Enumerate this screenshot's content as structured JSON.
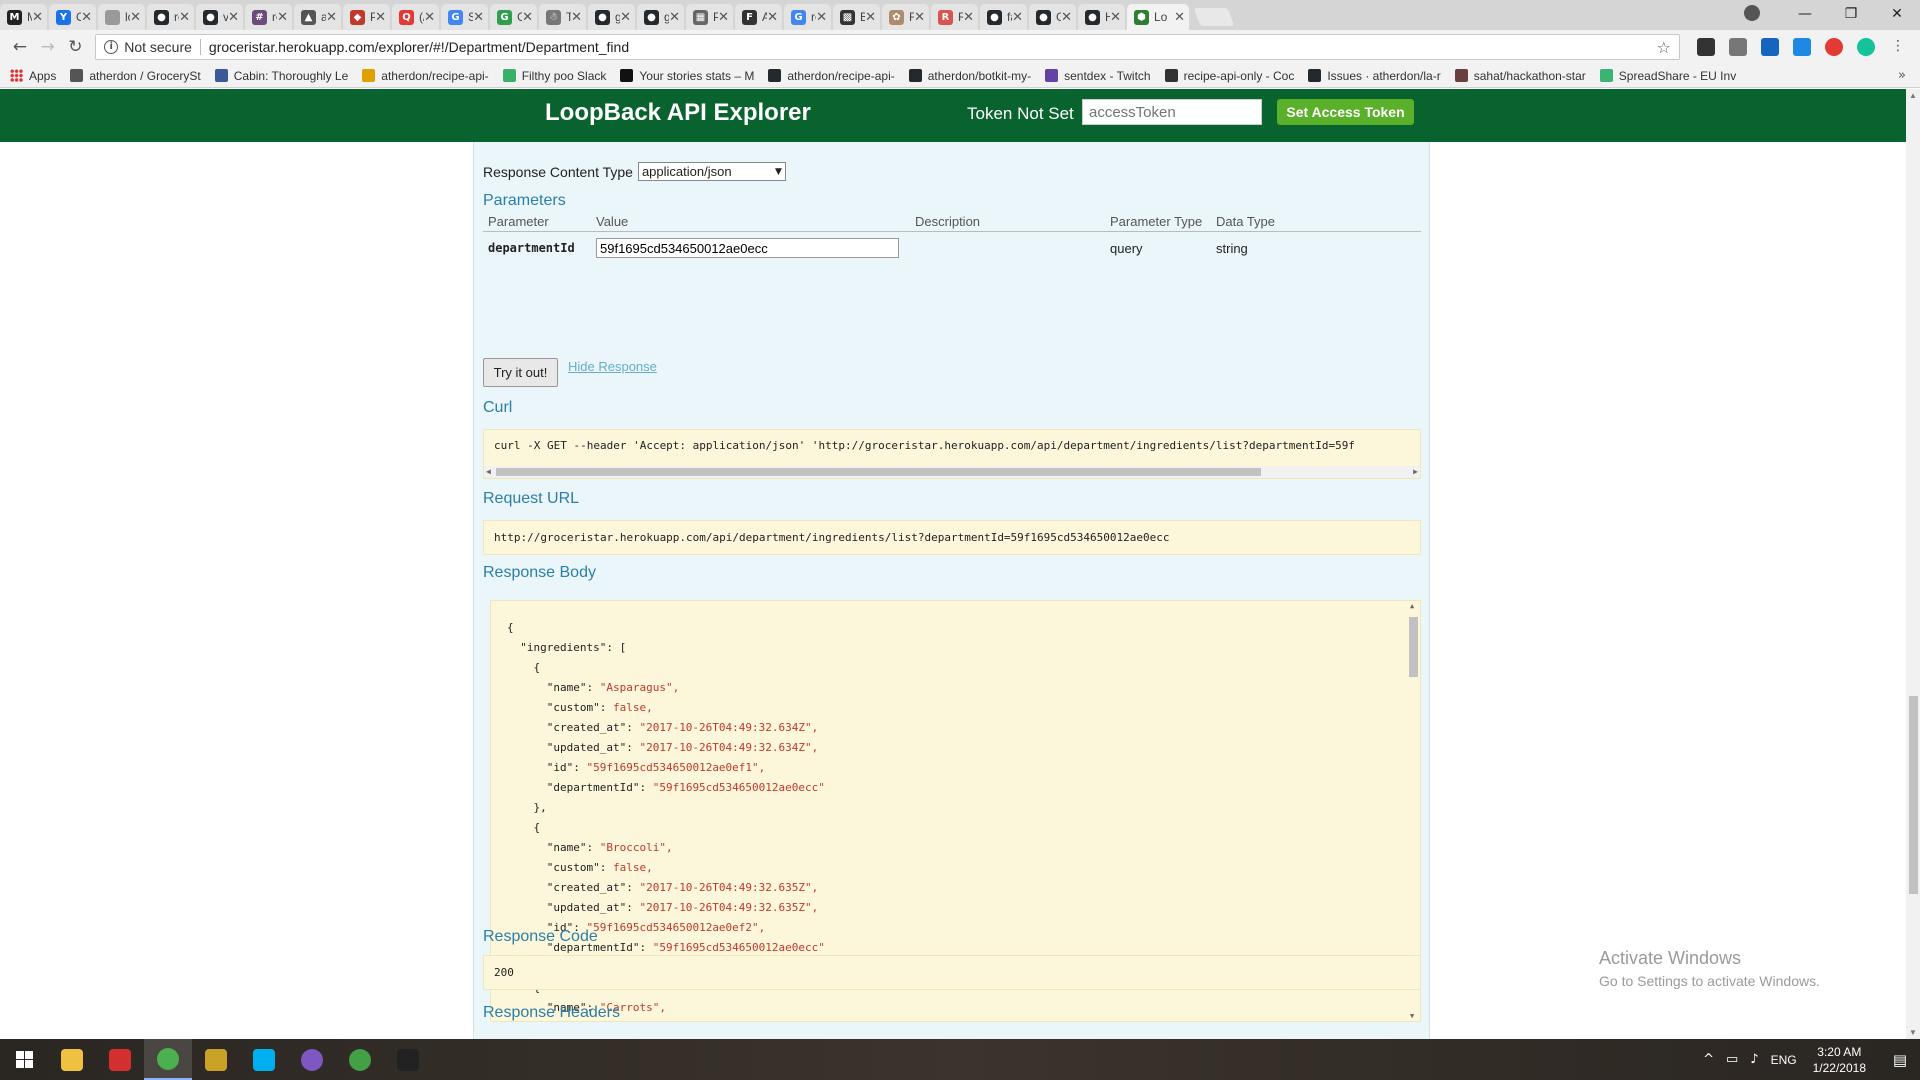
{
  "browser": {
    "tabs": [
      {
        "title": "M",
        "color": "#222222",
        "glyph": "M",
        "icon": "medium-icon"
      },
      {
        "title": "O",
        "color": "#1a73e8",
        "glyph": "Y",
        "icon": "vimeo-icon"
      },
      {
        "title": "lo",
        "color": "#999999",
        "glyph": "",
        "icon": "page-icon"
      },
      {
        "title": "re",
        "color": "#24292e",
        "glyph": "●",
        "icon": "github-icon"
      },
      {
        "title": "va",
        "color": "#24292e",
        "glyph": "●",
        "icon": "github-icon"
      },
      {
        "title": "re",
        "color": "#6b4b7a",
        "glyph": "#",
        "icon": "hash-icon"
      },
      {
        "title": "at",
        "color": "#555555",
        "glyph": "▲",
        "icon": "atlassian-icon"
      },
      {
        "title": "Pr",
        "color": "#c0392b",
        "glyph": "◆",
        "icon": "postman-icon"
      },
      {
        "title": "(/",
        "color": "#e53935",
        "glyph": "Q",
        "icon": "quora-icon"
      },
      {
        "title": "Sc",
        "color": "#4285f4",
        "glyph": "G",
        "icon": "google-icon"
      },
      {
        "title": "Gl",
        "color": "#2e9e4f",
        "glyph": "G",
        "icon": "glitch-icon"
      },
      {
        "title": "Tr",
        "color": "#777777",
        "glyph": "☃",
        "icon": "trello-icon"
      },
      {
        "title": "gr",
        "color": "#24292e",
        "glyph": "●",
        "icon": "github-icon"
      },
      {
        "title": "gr",
        "color": "#24292e",
        "glyph": "●",
        "icon": "github-icon"
      },
      {
        "title": "Pr",
        "color": "#666666",
        "glyph": "▦",
        "icon": "project-icon"
      },
      {
        "title": "A",
        "color": "#333333",
        "glyph": "F",
        "icon": "f-icon"
      },
      {
        "title": "re",
        "color": "#4285f4",
        "glyph": "G",
        "icon": "google-icon"
      },
      {
        "title": "Bl",
        "color": "#333333",
        "glyph": "▩",
        "icon": "blog-icon"
      },
      {
        "title": "Fu",
        "color": "#b08c6e",
        "glyph": "✿",
        "icon": "food-icon"
      },
      {
        "title": "Re",
        "color": "#d9534f",
        "glyph": "R",
        "icon": "reddit-icon"
      },
      {
        "title": "fa",
        "color": "#24292e",
        "glyph": "●",
        "icon": "github-icon"
      },
      {
        "title": "G",
        "color": "#24292e",
        "glyph": "●",
        "icon": "github-icon"
      },
      {
        "title": "H",
        "color": "#24292e",
        "glyph": "●",
        "icon": "github-icon"
      },
      {
        "title": "Lo",
        "color": "#2e7d32",
        "glyph": "⬢",
        "icon": "loopback-icon",
        "active": true
      }
    ],
    "not_secure_label": "Not secure",
    "url": "groceristar.herokuapp.com/explorer/#!/Department/Department_find",
    "bookmarks": [
      {
        "label": "Apps",
        "color": "#d33",
        "icon": "apps-icon"
      },
      {
        "label": "atherdon / GrocerySt",
        "color": "#555555",
        "icon": "atlassian-icon"
      },
      {
        "label": "Cabin: Thoroughly Le",
        "color": "#3b5998",
        "icon": "cabin-icon"
      },
      {
        "label": "atherdon/recipe-api-",
        "color": "#e0a000",
        "icon": "recipe-icon"
      },
      {
        "label": "Filthy poo Slack",
        "color": "#3aaf6a",
        "icon": "slack-icon"
      },
      {
        "label": "Your stories stats – M",
        "color": "#111111",
        "icon": "medium-icon"
      },
      {
        "label": "atherdon/recipe-api-",
        "color": "#24292e",
        "icon": "github-icon"
      },
      {
        "label": "atherdon/botkit-my-",
        "color": "#24292e",
        "icon": "github-icon"
      },
      {
        "label": "sentdex - Twitch",
        "color": "#6441a5",
        "icon": "twitch-icon"
      },
      {
        "label": "recipe-api-only - Coc",
        "color": "#333333",
        "icon": "codeship-icon"
      },
      {
        "label": "Issues · atherdon/la-r",
        "color": "#24292e",
        "icon": "github-icon"
      },
      {
        "label": "sahat/hackathon-star",
        "color": "#6a3f3f",
        "icon": "bookmark-icon"
      },
      {
        "label": "SpreadShare - EU Inv",
        "color": "#3cb371",
        "icon": "spreadshare-icon"
      }
    ]
  },
  "header": {
    "title": "LoopBack API Explorer",
    "token_label": "Token Not Set",
    "token_placeholder": "accessToken",
    "token_button": "Set Access Token"
  },
  "operation": {
    "response_content_type_label": "Response Content Type",
    "response_content_type_value": "application/json",
    "parameters_heading": "Parameters",
    "param_columns": [
      "Parameter",
      "Value",
      "Description",
      "Parameter Type",
      "Data Type"
    ],
    "param": {
      "name": "departmentId",
      "value": "59f1695cd534650012ae0ecc",
      "description": "",
      "parameter_type": "query",
      "data_type": "string"
    },
    "try_button": "Try it out!",
    "hide_response_link": "Hide Response",
    "curl_heading": "Curl",
    "curl_text": "curl -X GET --header 'Accept: application/json' 'http://groceristar.herokuapp.com/api/department/ingredients/list?departmentId=59f",
    "request_url_heading": "Request URL",
    "request_url": "http://groceristar.herokuapp.com/api/department/ingredients/list?departmentId=59f1695cd534650012ae0ecc",
    "response_body_heading": "Response Body",
    "response_body_lines": [
      "{",
      "  \"ingredients\": [",
      "    {",
      "      \"name\": \"Asparagus\",",
      "      \"custom\": false,",
      "      \"created_at\": \"2017-10-26T04:49:32.634Z\",",
      "      \"updated_at\": \"2017-10-26T04:49:32.634Z\",",
      "      \"id\": \"59f1695cd534650012ae0ef1\",",
      "      \"departmentId\": \"59f1695cd534650012ae0ecc\"",
      "    },",
      "    {",
      "      \"name\": \"Broccoli\",",
      "      \"custom\": false,",
      "      \"created_at\": \"2017-10-26T04:49:32.635Z\",",
      "      \"updated_at\": \"2017-10-26T04:49:32.635Z\",",
      "      \"id\": \"59f1695cd534650012ae0ef2\",",
      "      \"departmentId\": \"59f1695cd534650012ae0ecc\"",
      "    },",
      "    {",
      "      \"name\": \"Carrots\","
    ],
    "response_code_heading": "Response Code",
    "response_code": "200",
    "response_headers_heading": "Response Headers"
  },
  "watermark": {
    "line1": "Activate Windows",
    "line2": "Go to Settings to activate Windows."
  },
  "taskbar": {
    "apps": [
      {
        "icon": "file-explorer-icon",
        "color": "#f0c040"
      },
      {
        "icon": "vivaldi-icon",
        "color": "#d32f2f"
      },
      {
        "icon": "chrome-icon",
        "color": "#4caf50",
        "active": true
      },
      {
        "icon": "games-icon",
        "color": "#c9a227"
      },
      {
        "icon": "skype-icon",
        "color": "#00aff0"
      },
      {
        "icon": "app-purple-icon",
        "color": "#7e57c2"
      },
      {
        "icon": "app-green-icon",
        "color": "#43a047"
      },
      {
        "icon": "terminal-icon",
        "color": "#222222"
      }
    ],
    "language": "ENG",
    "time": "3:20 AM",
    "date": "1/22/2018"
  }
}
